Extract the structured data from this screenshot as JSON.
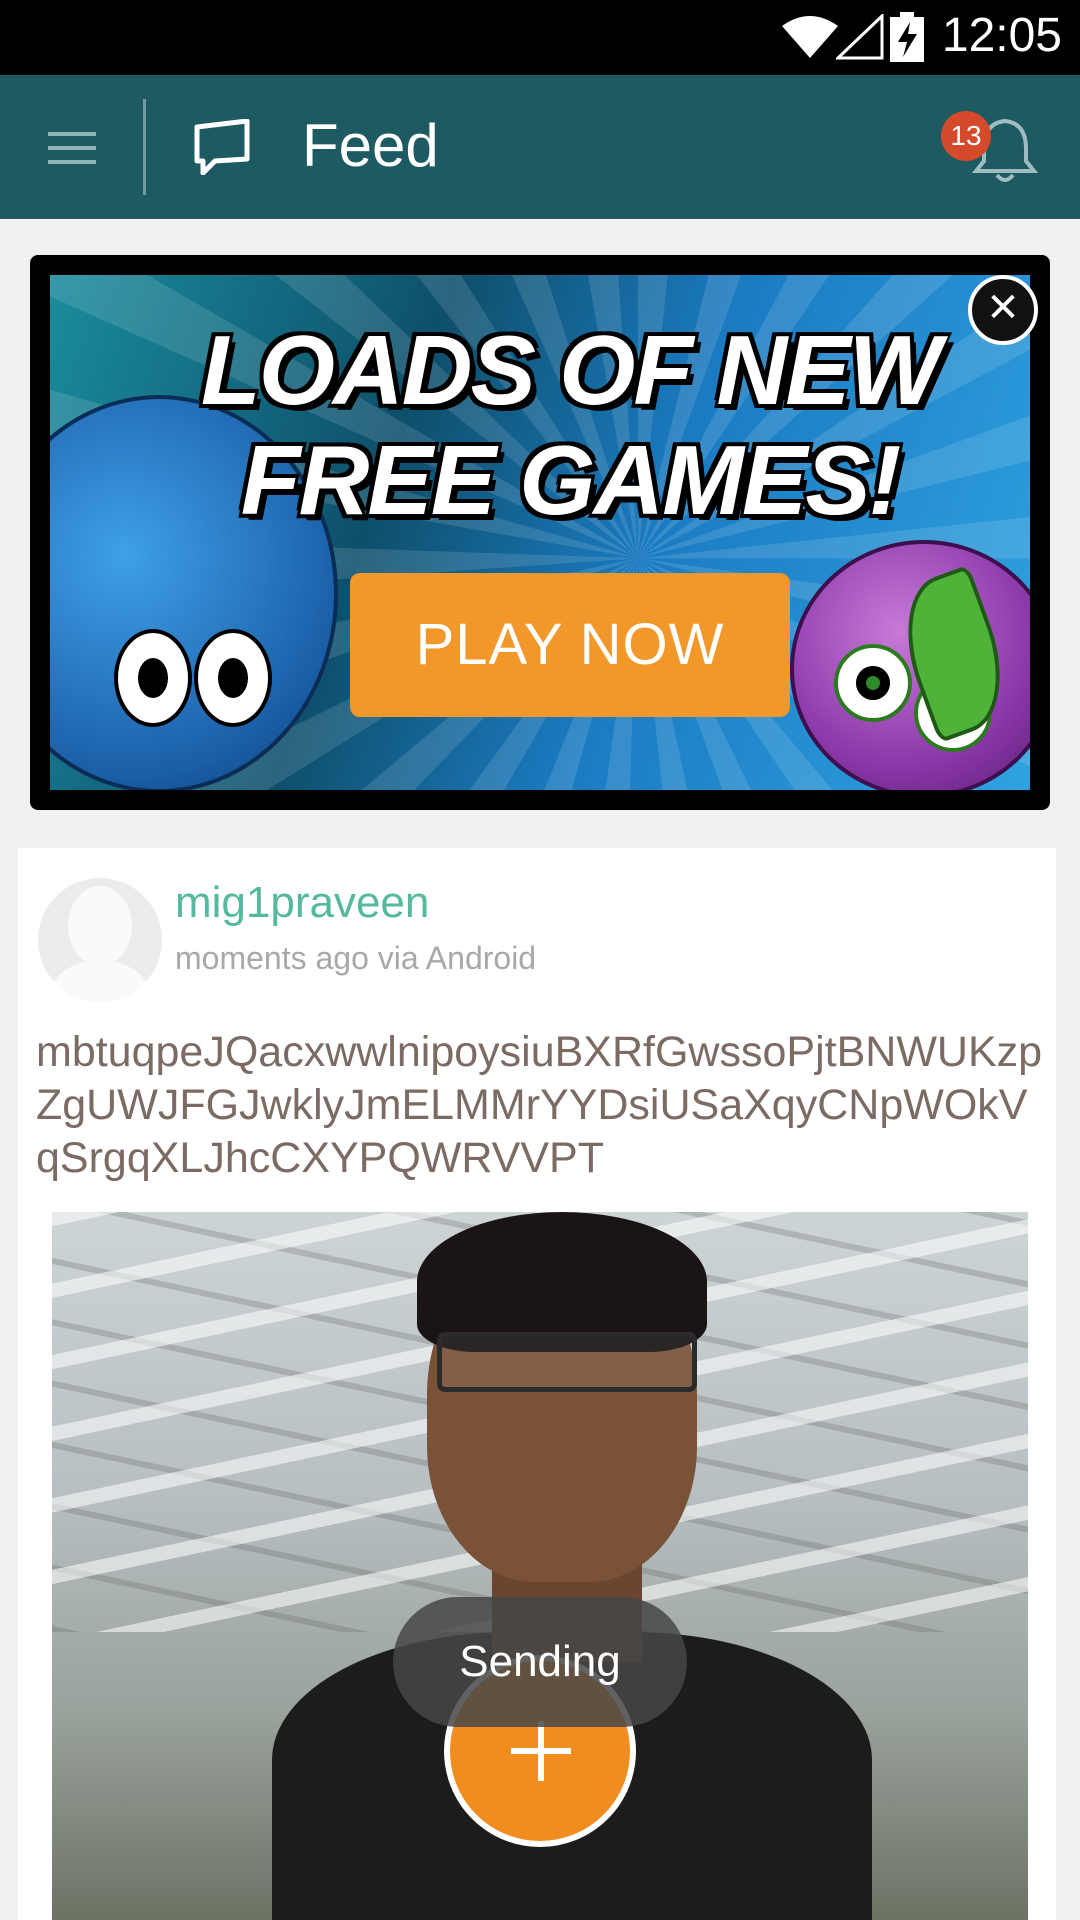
{
  "status_bar": {
    "time": "12:05",
    "icons": [
      "wifi-icon",
      "signal-icon",
      "battery-charging-icon"
    ]
  },
  "app_bar": {
    "title": "Feed",
    "notification_count": "13"
  },
  "ad": {
    "headline_line1": "LOADS OF NEW",
    "headline_line2": "FREE GAMES!",
    "button_label": "PLAY NOW",
    "close_label": "✕"
  },
  "post": {
    "username": "mig1praveen",
    "meta": "moments ago via Android",
    "text": "mbtuqpeJQacxwwlnipoysiuBXRfGwssoPjtBNWUKzpZgUWJFGJwklyJmELMMrYYDsiUSaXqyCNpWOkVqSrgqXLJhcCXYPQWRVVPT"
  },
  "toast": {
    "text": "Sending"
  },
  "colors": {
    "app_bar": "#1e5a61",
    "accent": "#f08c20",
    "username": "#55b99e"
  }
}
